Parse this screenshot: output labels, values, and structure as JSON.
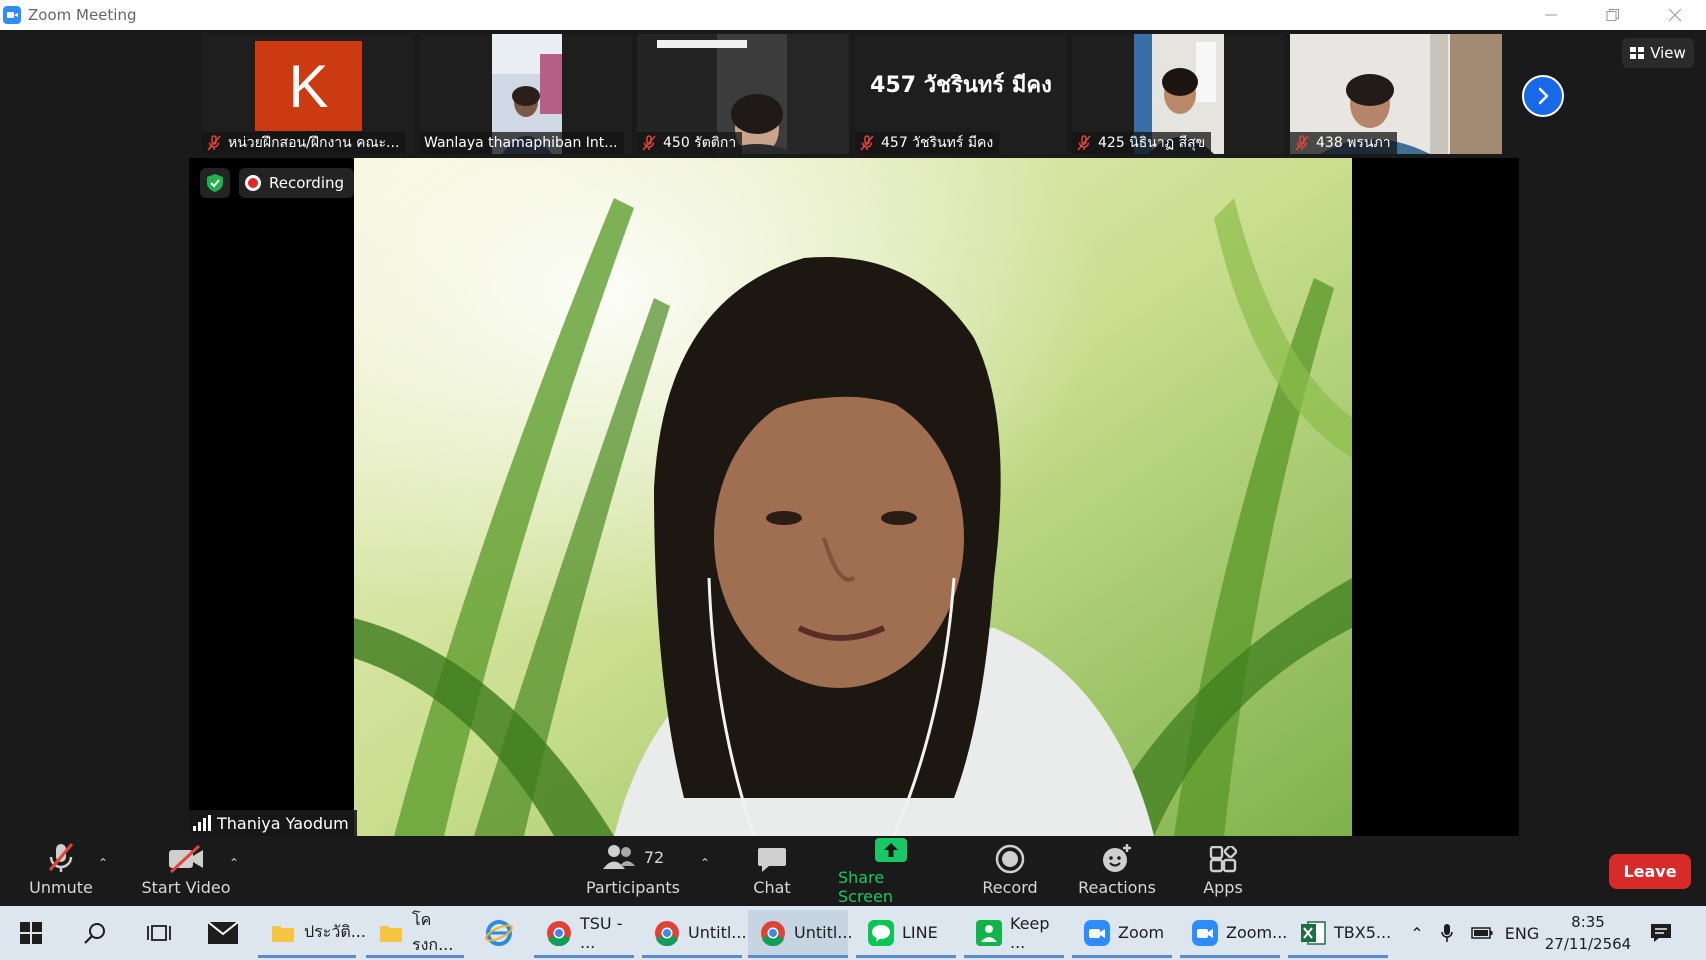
{
  "window": {
    "title": "Zoom Meeting"
  },
  "thumbnails": [
    {
      "name": "หน่วยฝึกสอน/ฝึกงาน คณะ...",
      "avatar_letter": "K",
      "muted": true
    },
    {
      "name": "Wanlaya thamaphiban Int...",
      "muted": false
    },
    {
      "name": "450 รัตติกา",
      "muted": true
    },
    {
      "name": "457 วัชรินทร์  มีคง",
      "display_name": "457 วัชรินทร์  มีคง",
      "muted": true
    },
    {
      "name": "425 นิธินาฏ สีสุข",
      "muted": true
    },
    {
      "name": "438 พรนภา",
      "muted": true
    }
  ],
  "view_button": {
    "label": "View"
  },
  "main": {
    "recording_label": "Recording",
    "speaker_name": "Thaniya Yaodum"
  },
  "toolbar": {
    "unmute": "Unmute",
    "start_video": "Start Video",
    "participants": "Participants",
    "participants_count": "72",
    "chat": "Chat",
    "share_screen": "Share Screen",
    "record": "Record",
    "reactions": "Reactions",
    "apps": "Apps",
    "leave": "Leave"
  },
  "taskbar": {
    "apps": [
      {
        "label": "ประวัติ..."
      },
      {
        "label": "โครงก..."
      },
      {
        "label": "TSU - ..."
      },
      {
        "label": "Untitl..."
      },
      {
        "label": "Untitl..."
      },
      {
        "label": "LINE"
      },
      {
        "label": "Keep ..."
      },
      {
        "label": "Zoom"
      },
      {
        "label": "Zoom..."
      },
      {
        "label": "TBX5..."
      }
    ],
    "language": "ENG",
    "time": "8:35",
    "date": "27/11/2564"
  },
  "colors": {
    "accent_blue": "#2d8cff",
    "share_green": "#17c964",
    "leave_red": "#d92a2a",
    "avatar_orange": "#cc3a12"
  }
}
